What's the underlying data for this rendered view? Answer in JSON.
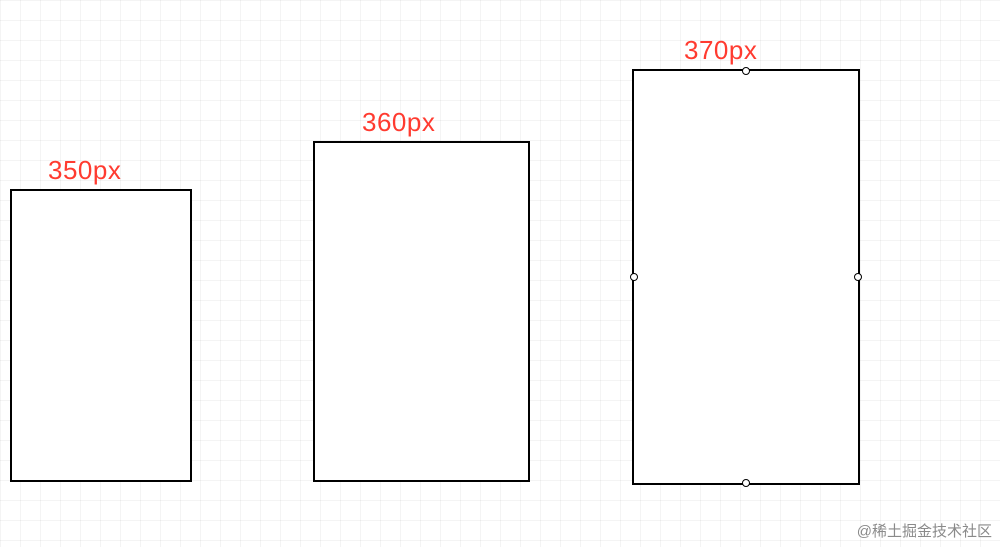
{
  "boxes": {
    "box1": {
      "label": "350px",
      "selected": false
    },
    "box2": {
      "label": "360px",
      "selected": false
    },
    "box3": {
      "label": "370px",
      "selected": true
    }
  },
  "watermark": "@稀土掘金技术社区",
  "colors": {
    "label": "#ff3b30",
    "border": "#000000",
    "handle_fill": "#ffffff",
    "handle_border": "#000000",
    "grid": "rgba(0,0,0,0.05)"
  },
  "chart_data": {
    "type": "bar",
    "title": "",
    "xlabel": "",
    "ylabel": "",
    "categories": [
      "350px",
      "360px",
      "370px"
    ],
    "values": [
      350,
      360,
      370
    ],
    "ylim": [
      0,
      400
    ]
  }
}
